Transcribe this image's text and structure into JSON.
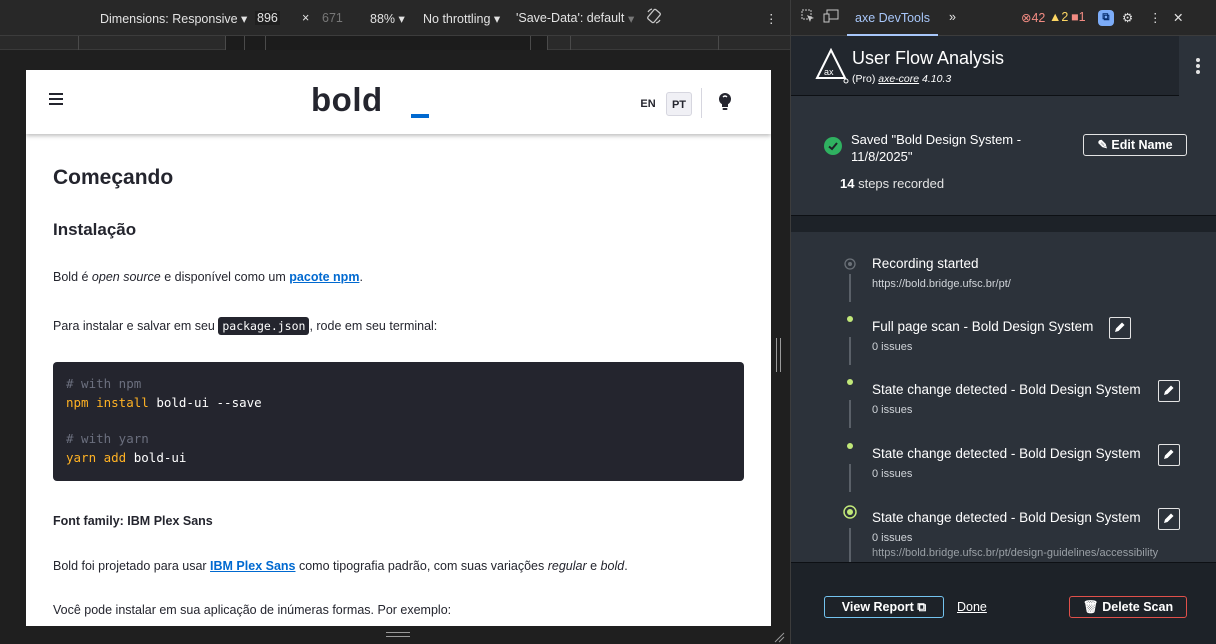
{
  "emulation": {
    "dimensions_label": "Dimensions: Responsive ▾",
    "width": "896",
    "times": "×",
    "height": "671",
    "zoom": "88% ▾",
    "throttling": "No throttling ▾",
    "save_data": "'Save-Data': default",
    "save_data_arrow": "▾",
    "more": "⋮"
  },
  "page": {
    "logo": "bold",
    "lang_en": "EN",
    "lang_pt": "PT",
    "h1": "Começando",
    "h2": "Instalação",
    "p1": {
      "a": "Bold é ",
      "b": "open source",
      "c": " e disponível como um ",
      "link": "pacote npm",
      "d": "."
    },
    "p2": {
      "a": "Para instalar e salvar em seu ",
      "code": "package.json",
      "b": ", rode em seu terminal:"
    },
    "code": {
      "c1": "# with npm",
      "l1_kw": "npm install",
      "l1_rest": " bold-ui --save",
      "c2": "# with yarn",
      "l2_kw": "yarn add",
      "l2_rest": " bold-ui"
    },
    "h3": "Font family: IBM Plex Sans",
    "p3": {
      "a": "Bold foi projetado para usar ",
      "link": "IBM Plex Sans",
      "b": " como tipografia padrão, com suas variações ",
      "c": "regular",
      "d": " e ",
      "e": "bold",
      "f": "."
    },
    "p4": "Você pode instalar em sua aplicação de inúmeras formas. Por exemplo:"
  },
  "devtools": {
    "tab": "axe DevTools",
    "more_tabs": "»",
    "errors": "42",
    "warnings": "2",
    "issues": "1",
    "ext_badge": "⧉",
    "settings": "⚙",
    "menu": "⋮",
    "close": "✕"
  },
  "axe": {
    "title": "User Flow Analysis",
    "sub_prefix": "(Pro) ",
    "sub_link": "axe-core",
    "sub_version": " 4.10.3",
    "saved_title": "Saved \"Bold Design System - 11/8/2025\"",
    "steps_count": "14",
    "steps_label": " steps recorded",
    "edit_name": "✎ Edit Name",
    "steps": [
      {
        "name": "Recording started",
        "meta": "https://bold.bridge.ufsc.br/pt/"
      },
      {
        "name": "Full page scan - Bold Design System",
        "meta": "0 issues"
      },
      {
        "name": "State change detected - Bold Design System",
        "meta": "0 issues"
      },
      {
        "name": "State change detected - Bold Design System",
        "meta": "0 issues"
      },
      {
        "name": "State change detected - Bold Design System",
        "meta": "0 issues",
        "url": "https://bold.bridge.ufsc.br/pt/design-guidelines/accessibility"
      }
    ],
    "view_report": "View Report ⧉",
    "done": "Done",
    "delete_scan": "🗑 Delete Scan"
  },
  "colors": {
    "accent_blue": "#0069d0",
    "axe_green": "#c1e879",
    "delete_red": "#e0504a",
    "report_blue": "#73c3ef"
  }
}
